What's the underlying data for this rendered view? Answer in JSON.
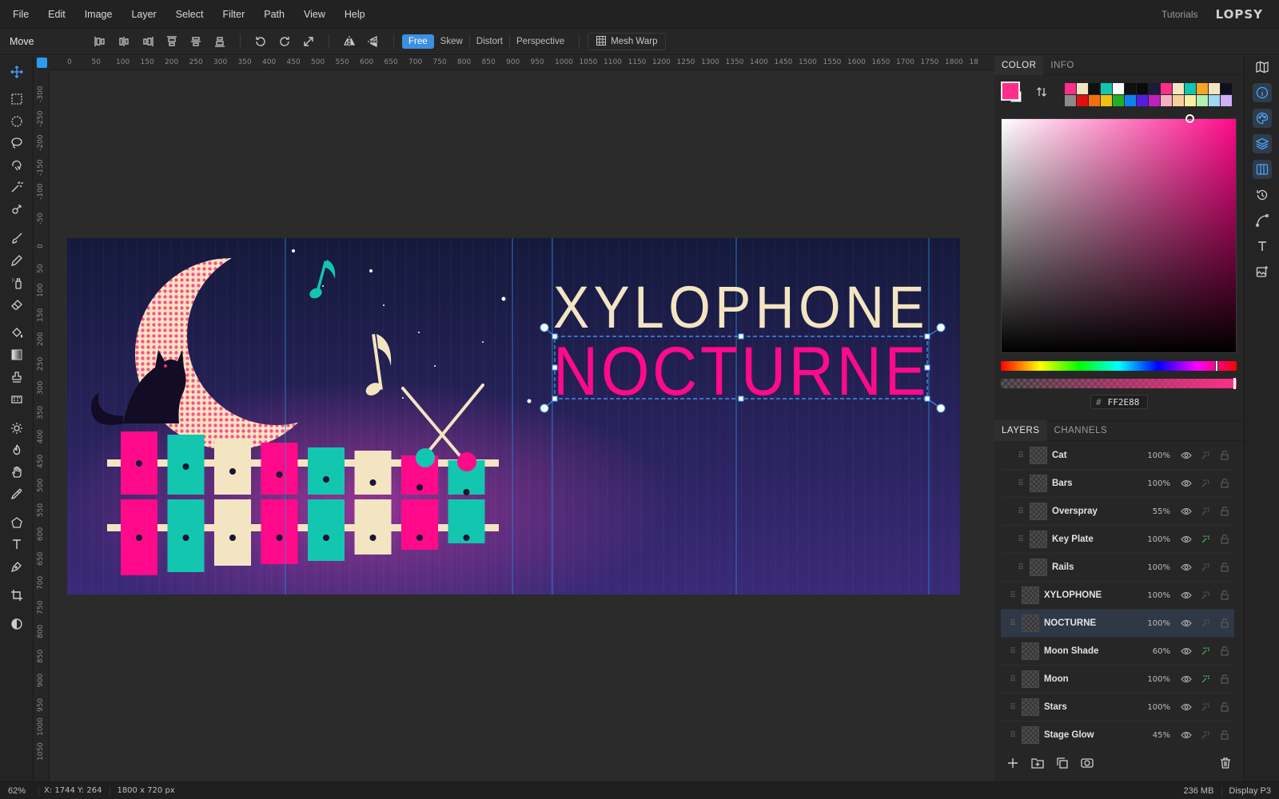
{
  "menu": {
    "items": [
      "File",
      "Edit",
      "Image",
      "Layer",
      "Select",
      "Filter",
      "Path",
      "View",
      "Help"
    ],
    "tutorials": "Tutorials",
    "logo": "LOPSY"
  },
  "options": {
    "tool_name": "Move",
    "transform_modes": [
      "Free",
      "Skew",
      "Distort",
      "Perspective"
    ],
    "active_mode": "Free",
    "mesh_warp": "Mesh Warp"
  },
  "rulers": {
    "top": [
      "0",
      "50",
      "100",
      "150",
      "200",
      "250",
      "300",
      "350",
      "400",
      "450",
      "500",
      "550",
      "600",
      "650",
      "700",
      "750",
      "800",
      "850",
      "900",
      "950",
      "1000",
      "1050",
      "1100",
      "1150",
      "1200",
      "1250",
      "1300",
      "1350",
      "1400",
      "1450",
      "1500",
      "1550",
      "1600",
      "1650",
      "1700",
      "1750",
      "1800",
      "18"
    ],
    "left": [
      "-300",
      "-250",
      "-200",
      "-150",
      "-100",
      "-50",
      "0",
      "50",
      "100",
      "150",
      "200",
      "250",
      "300",
      "350",
      "400",
      "450",
      "500",
      "550",
      "600",
      "650",
      "700",
      "750",
      "800",
      "850",
      "900",
      "950",
      "1000",
      "1050"
    ]
  },
  "canvas": {
    "title_line1": "XYLOPHONE",
    "title_line2": "NOCTURNE",
    "colors": {
      "pink": "#ff0a8a",
      "teal": "#12c6b0",
      "cream": "#f4e5c2",
      "night_top": "#141a3c",
      "night_bottom": "#3a2a78"
    }
  },
  "color_panel": {
    "tabs": [
      "COLOR",
      "INFO"
    ],
    "active_tab": "COLOR",
    "foreground": "#FF2E88",
    "background": "#FFFFFF",
    "hex_value": "FF2E88",
    "swatches_row1": [
      "#ff2e88",
      "#f4e5c2",
      "#101010",
      "#12c6b0",
      "#ffffff",
      "#101010",
      "#0a0a0a",
      "#1b1b3a",
      "#ff2e88",
      "#f4e5c2",
      "#12c6b0",
      "#f5a623",
      "#f4e5c2",
      "#0f0f1f"
    ],
    "swatches_row2": [
      "#8a8a8a",
      "#e01010",
      "#f07010",
      "#f0c010",
      "#20b020",
      "#1080f0",
      "#5020e0",
      "#c020c0",
      "#f4b0c0",
      "#f8d0a0",
      "#f8f0a0",
      "#b0f0b0",
      "#a0d8f8",
      "#d0b0f8"
    ]
  },
  "layers_panel": {
    "tabs": [
      "LAYERS",
      "CHANNELS"
    ],
    "active_tab": "LAYERS",
    "selected": "NOCTURNE",
    "layers": [
      {
        "name": "Cat",
        "opacity": "100%",
        "indent": 1,
        "fx": "dim"
      },
      {
        "name": "Bars",
        "opacity": "100%",
        "indent": 1,
        "fx": "dim"
      },
      {
        "name": "Overspray",
        "opacity": "55%",
        "indent": 1,
        "fx": "dim"
      },
      {
        "name": "Key Plate",
        "opacity": "100%",
        "indent": 1,
        "fx": "green"
      },
      {
        "name": "Rails",
        "opacity": "100%",
        "indent": 1,
        "fx": "dim"
      },
      {
        "name": "XYLOPHONE",
        "opacity": "100%",
        "indent": 0,
        "fx": "dim"
      },
      {
        "name": "NOCTURNE",
        "opacity": "100%",
        "indent": 0,
        "fx": "dim"
      },
      {
        "name": "Moon Shade",
        "opacity": "60%",
        "indent": 0,
        "fx": "green"
      },
      {
        "name": "Moon",
        "opacity": "100%",
        "indent": 0,
        "fx": "green"
      },
      {
        "name": "Stars",
        "opacity": "100%",
        "indent": 0,
        "fx": "dim"
      },
      {
        "name": "Stage Glow",
        "opacity": "45%",
        "indent": 0,
        "fx": "dim"
      }
    ]
  },
  "status": {
    "zoom": "62%",
    "coords": "X: 1744  Y: 264",
    "dims": "1800 x 720 px",
    "memory": "236 MB",
    "profile": "Display P3"
  }
}
